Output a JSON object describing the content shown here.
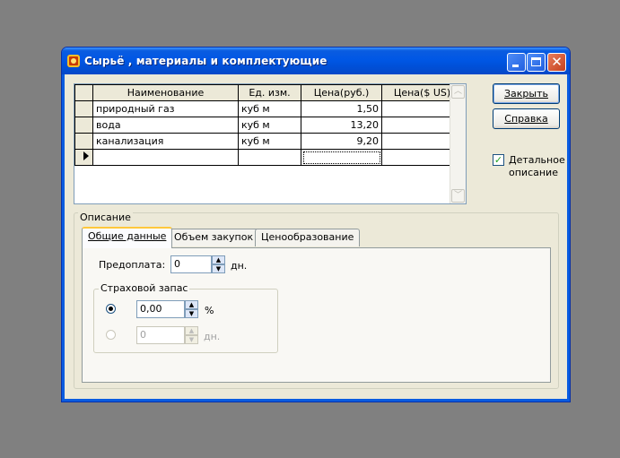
{
  "window": {
    "title": "Сырьё , материалы и комплектующие"
  },
  "grid": {
    "columns": [
      "Наименование",
      "Ед. изм.",
      "Цена(руб.)",
      "Цена($ US)"
    ],
    "rows": [
      [
        "природный газ",
        "куб м",
        "1,50",
        ""
      ],
      [
        "вода",
        "куб м",
        "13,20",
        ""
      ],
      [
        "канализация",
        "куб м",
        "9,20",
        ""
      ]
    ]
  },
  "buttons": {
    "close": "Закрыть",
    "help": "Справка"
  },
  "detail": {
    "label_line1": "Детальное",
    "label_line2": "описание",
    "checked": true
  },
  "description": {
    "legend": "Описание",
    "tabs": [
      "Общие данные",
      "Объем закупок",
      "Ценообразование"
    ],
    "prepay_label": "Предоплата:",
    "prepay_value": "0",
    "prepay_unit": "дн.",
    "reserve_legend": "Страховой запас",
    "percent_value": "0,00",
    "percent_unit": "%",
    "days_value": "0",
    "days_unit": "дн."
  }
}
